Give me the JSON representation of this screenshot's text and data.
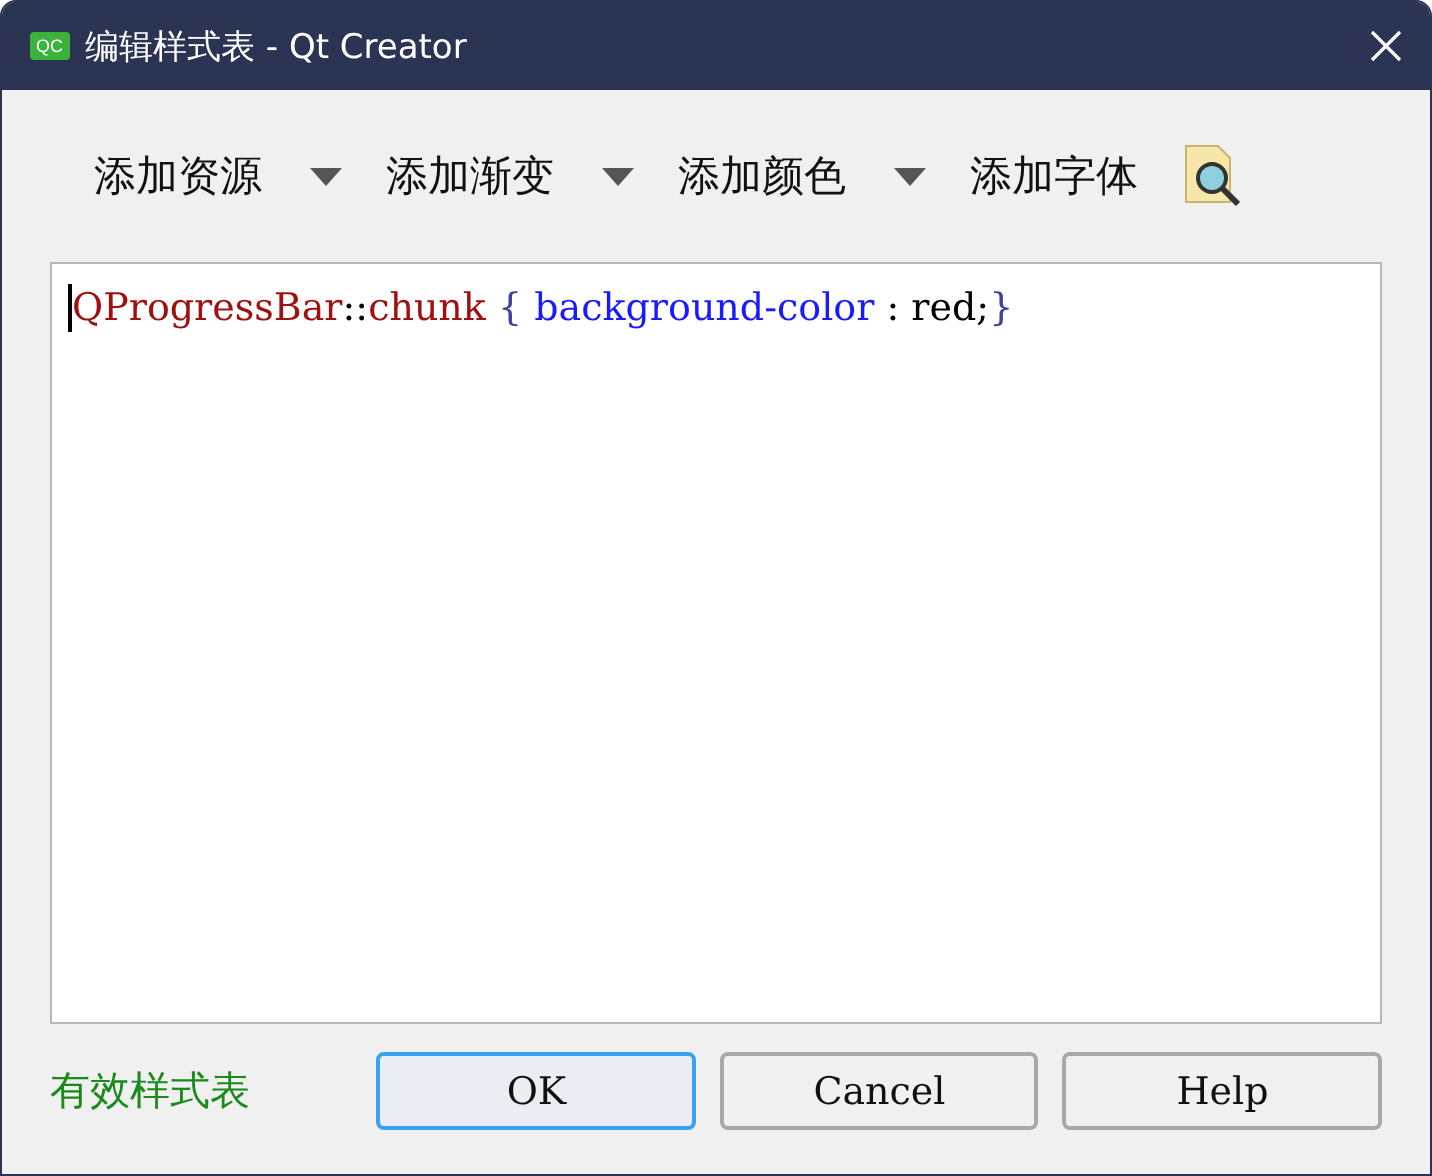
{
  "window": {
    "title": "编辑样式表 - Qt Creator",
    "app_badge": "QC"
  },
  "toolbar": [
    {
      "label": "添加资源",
      "has_menu": true
    },
    {
      "label": "添加渐变",
      "has_menu": true
    },
    {
      "label": "添加颜色",
      "has_menu": true
    },
    {
      "label": "添加字体",
      "has_menu": false
    }
  ],
  "editor": {
    "lines": [
      [
        {
          "kind": "selector",
          "text": "QProgressBar"
        },
        {
          "kind": "plain",
          "text": "::"
        },
        {
          "kind": "selector",
          "text": "chunk"
        },
        {
          "kind": "brace",
          "text": " { "
        },
        {
          "kind": "property",
          "text": "background-color"
        },
        {
          "kind": "plain",
          "text": " : red;"
        },
        {
          "kind": "brace",
          "text": "}"
        }
      ]
    ]
  },
  "status": {
    "text": "有效样式表",
    "valid": true
  },
  "buttons": [
    {
      "label": "OK",
      "focused": true
    },
    {
      "label": "Cancel",
      "focused": false
    },
    {
      "label": "Help",
      "focused": false
    }
  ]
}
